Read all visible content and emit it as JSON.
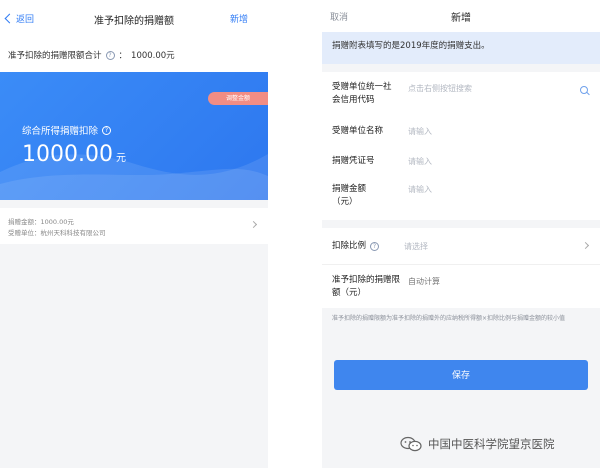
{
  "left": {
    "nav": {
      "back_label": "返回",
      "title": "准予扣除的捐赠额",
      "add_label": "新增"
    },
    "total": {
      "label": "准予扣除的捐赠限额合计",
      "separator": "：",
      "value": "1000.00元"
    },
    "card": {
      "badge": "调整金额",
      "label": "综合所得捐赠扣除",
      "amount": "1000.00",
      "unit": "元"
    },
    "item": {
      "amount_line": "捐赠金额：1000.00元",
      "org_line": "受赠单位：杭州天科科技有限公司"
    }
  },
  "right": {
    "nav": {
      "cancel_label": "取消",
      "title": "新增"
    },
    "notice": "捐赠附表填写的是2019年度的捐赠支出。",
    "form": {
      "credit_code": {
        "label": "受赠单位统一社会信用代码",
        "placeholder": "点击右侧按钮搜索"
      },
      "org_name": {
        "label": "受赠单位名称",
        "placeholder": "请输入"
      },
      "voucher": {
        "label": "捐赠凭证号",
        "placeholder": "请输入"
      },
      "amount": {
        "label": "捐赠金额（元）",
        "placeholder": "请输入"
      }
    },
    "ratio": {
      "label": "扣除比例",
      "placeholder": "请选择"
    },
    "limit": {
      "label": "准予扣除的捐赠限额（元）",
      "value": "自动计算"
    },
    "footnote": "准予扣除的捐赠限额为准予扣除的捐赠外的应纳税所得额×扣除比例与捐赠金额的较小值",
    "save_label": "保存"
  },
  "watermark": "中国中医科学院望京医院",
  "colors": {
    "accent": "#2f7bf5",
    "card": "#3b8cf7",
    "badge": "#f28d84",
    "save": "#3f86ee"
  }
}
